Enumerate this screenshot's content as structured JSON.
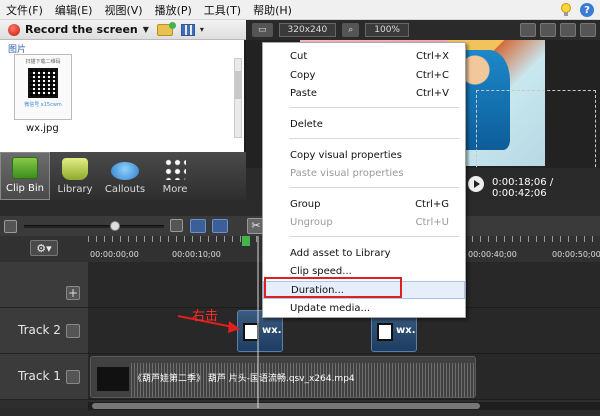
{
  "menubar": {
    "items": [
      "文件(F)",
      "编辑(E)",
      "视图(V)",
      "播放(P)",
      "工具(T)",
      "帮助(H)"
    ]
  },
  "left_toolbar": {
    "record_label": "Record the screen"
  },
  "clip_bin": {
    "section_label": "图片",
    "thumb_top_text": "扫描下载二维码",
    "thumb_bottom_text": "微信号 x15cwm",
    "file_name": "wx.jpg"
  },
  "tabs": [
    {
      "label": "Clip Bin",
      "icon": "clip-bin-icon"
    },
    {
      "label": "Library",
      "icon": "library-icon"
    },
    {
      "label": "Callouts",
      "icon": "callouts-icon"
    },
    {
      "label": "More",
      "icon": "more-icon"
    }
  ],
  "preview_toolbar": {
    "size": "320x240",
    "zoom": "100%"
  },
  "playback": {
    "timecode": "0:00:18;06 / 0:00:42;06"
  },
  "ruler": {
    "labels": [
      "00:00:00;00",
      "00:00:10;00",
      "00:00:40;00",
      "00:00:50;00"
    ]
  },
  "tracks": {
    "track2": {
      "label": "Track 2",
      "clip_a": "wx.",
      "clip_b": "wx."
    },
    "track1": {
      "label": "Track 1",
      "clip_title": "《葫芦娃第二季》 葫芦 片头-国语流畅.qsv_x264.mp4"
    }
  },
  "annotation": {
    "text": "右击"
  },
  "context_menu": {
    "items": [
      {
        "label": "Cut",
        "shortcut": "Ctrl+X",
        "disabled": false
      },
      {
        "label": "Copy",
        "shortcut": "Ctrl+C",
        "disabled": false
      },
      {
        "label": "Paste",
        "shortcut": "Ctrl+V",
        "disabled": false
      },
      {
        "label": "Delete",
        "shortcut": "",
        "disabled": false
      },
      {
        "label": "Copy visual properties",
        "shortcut": "",
        "disabled": false
      },
      {
        "label": "Paste visual properties",
        "shortcut": "",
        "disabled": true
      },
      {
        "label": "Group",
        "shortcut": "Ctrl+G",
        "disabled": false
      },
      {
        "label": "Ungroup",
        "shortcut": "Ctrl+U",
        "disabled": true
      },
      {
        "label": "Add asset to Library",
        "shortcut": "",
        "disabled": false
      },
      {
        "label": "Clip speed...",
        "shortcut": "",
        "disabled": false
      },
      {
        "label": "Duration...",
        "shortcut": "",
        "disabled": false
      },
      {
        "label": "Update media...",
        "shortcut": "",
        "disabled": false
      }
    ]
  },
  "colors": {
    "annotation_red": "#e02020",
    "menu_hover": "#e6eef9"
  }
}
